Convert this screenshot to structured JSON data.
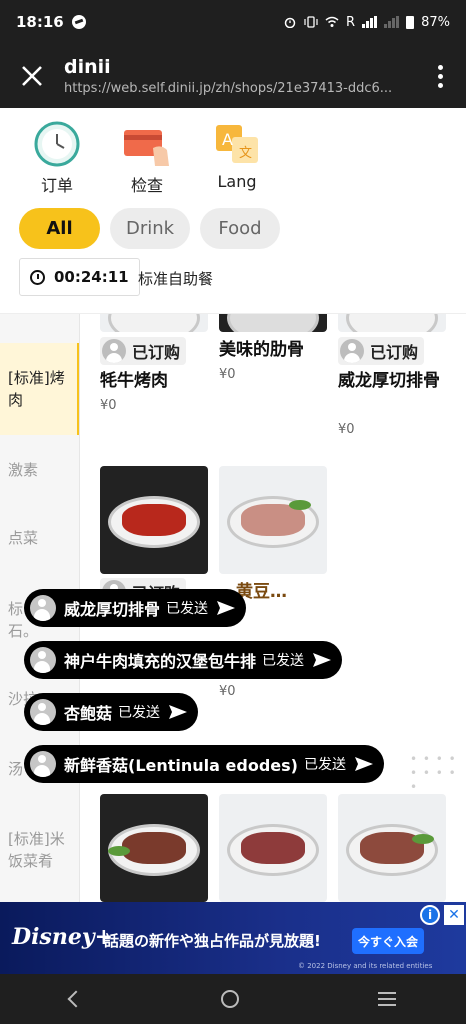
{
  "status_bar": {
    "time": "18:16",
    "network_letter": "R",
    "battery": "87%"
  },
  "browser": {
    "site_name": "dinii",
    "url": "https://web.self.dinii.jp/zh/shops/21e37413-ddc6..."
  },
  "nav_icons": [
    {
      "label": "订单",
      "icon": "clock-icon"
    },
    {
      "label": "检查",
      "icon": "card-hand-icon"
    },
    {
      "label": "Lang",
      "icon": "translate-icon"
    }
  ],
  "tabs": [
    {
      "label": "All",
      "active": true
    },
    {
      "label": "Drink",
      "active": false
    },
    {
      "label": "Food",
      "active": false
    }
  ],
  "timer": {
    "elapsed": "00:24:11",
    "course": "标准自助餐"
  },
  "sidebar": {
    "items": [
      {
        "label": "[标准]烤肉",
        "active": true
      },
      {
        "label": "激素",
        "active": false
      },
      {
        "label": "点菜",
        "active": false
      },
      {
        "label": "标…石。",
        "active": false
      },
      {
        "label": "沙拉",
        "active": false
      },
      {
        "label": "汤",
        "active": false
      },
      {
        "label": "[标准]米饭菜肴",
        "active": false
      }
    ]
  },
  "products": [
    {
      "ordered_label": "已订购",
      "name": "牦牛烤肉",
      "price": "¥0"
    },
    {
      "ordered_label": "",
      "name": "美味的肋骨",
      "price": "¥0"
    },
    {
      "ordered_label": "已订购",
      "name": "威龙厚切排骨",
      "price": "¥0"
    },
    {
      "ordered_label": "已订购",
      "name": "…",
      "price": ""
    },
    {
      "ordered_label": "",
      "name": "…黄豆…",
      "price": "¥0"
    }
  ],
  "toasts": [
    {
      "name": "威龙厚切排骨",
      "status": "已发送"
    },
    {
      "name": "神户牛肉填充的汉堡包牛排",
      "status": "已发送"
    },
    {
      "name": "杏鲍菇",
      "status": "已发送"
    },
    {
      "name": "新鲜香菇(Lentinula edodes)",
      "status": "已发送"
    }
  ],
  "ad": {
    "brand": "Disney+",
    "headline": "話題の新作や独占作品が見放題!",
    "cta": "今すぐ入会",
    "copyright": "© 2022 Disney and its related entities"
  },
  "colors": {
    "accent": "#f7c21b",
    "dark_bar": "#1f1f1f",
    "toast_bg": "#000000",
    "ad_bg": "#0a1a5c"
  }
}
